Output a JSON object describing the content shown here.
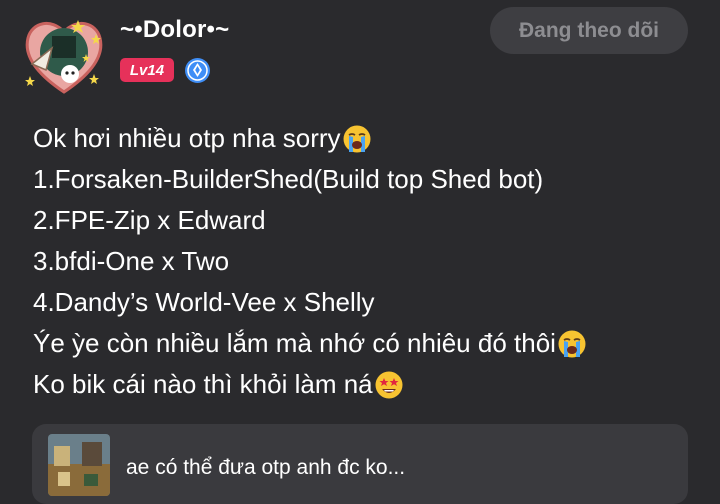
{
  "profile": {
    "username": "~•Dolor•~",
    "level": "Lv14",
    "follow_button_label": "Đang theo dõi"
  },
  "post": {
    "lines": [
      "Ok hơi nhiều otp nha sorry",
      "1.Forsaken-BuilderShed(Build top Shed bot)",
      "2.FPE-Zip x Edward",
      "3.bfdi-One x Two",
      "4.Dandy’s World-Vee x Shelly",
      "Ýe ỳe còn nhiều lắm mà nhớ có nhiêu đó thôi",
      "Ko bik cái nào thì khỏi làm ná"
    ],
    "emojis": [
      "loudly-crying-face",
      "loudly-crying-face",
      "star-struck-face"
    ]
  },
  "linked_post": {
    "title": "ae có thể đưa otp anh đc ko..."
  },
  "colors": {
    "background": "#2a2a2d",
    "level_badge": "#e6315a",
    "verify_badge": "#3f8ef6",
    "follow_button_bg": "#3e3e42",
    "follow_button_text": "#8d8d91",
    "card_bg": "#3a3a3e"
  }
}
